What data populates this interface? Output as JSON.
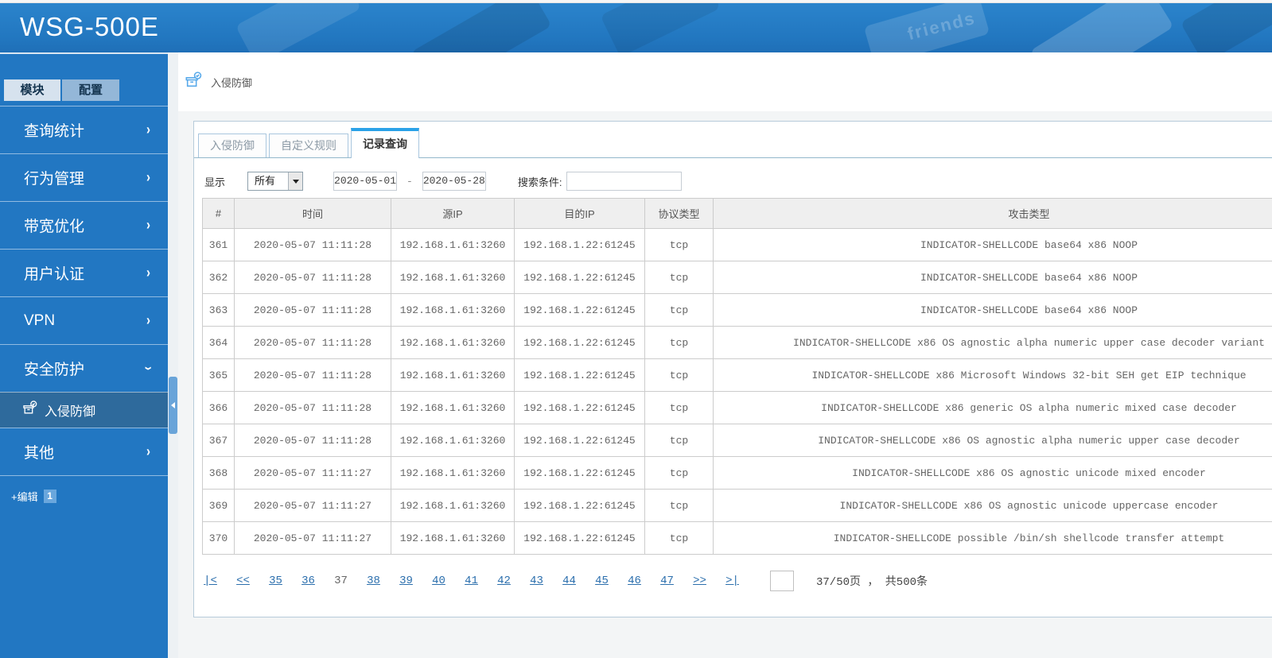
{
  "header": {
    "title": "WSG-500E",
    "keyboard_key_label": "friends"
  },
  "sidebar": {
    "tabs": [
      {
        "label": "模块",
        "active": true
      },
      {
        "label": "配置",
        "active": false
      }
    ],
    "menu": [
      {
        "name": "sidebar-item-query-stats",
        "label": "查询统计",
        "type": "group",
        "state": "collapsed"
      },
      {
        "name": "sidebar-item-behavior-mgmt",
        "label": "行为管理",
        "type": "group",
        "state": "collapsed"
      },
      {
        "name": "sidebar-item-bandwidth",
        "label": "带宽优化",
        "type": "group",
        "state": "collapsed"
      },
      {
        "name": "sidebar-item-user-auth",
        "label": "用户认证",
        "type": "group",
        "state": "collapsed"
      },
      {
        "name": "sidebar-item-vpn",
        "label": "VPN",
        "type": "group",
        "state": "collapsed"
      },
      {
        "name": "sidebar-item-security",
        "label": "安全防护",
        "type": "group",
        "state": "expanded"
      },
      {
        "name": "sidebar-item-ips",
        "label": "入侵防御",
        "type": "sub",
        "icon": "box-check-icon",
        "active": true
      },
      {
        "name": "sidebar-item-other",
        "label": "其他",
        "type": "group",
        "state": "collapsed"
      }
    ],
    "edit": {
      "label": "+编辑",
      "badge": "1"
    }
  },
  "breadcrumb": {
    "icon": "box-check-icon",
    "label": "入侵防御"
  },
  "tabs": [
    {
      "label": "入侵防御",
      "active": false
    },
    {
      "label": "自定义规则",
      "active": false
    },
    {
      "label": "记录查询",
      "active": true
    }
  ],
  "filters": {
    "display_label": "显示",
    "display_value": "所有",
    "date_from": "2020-05-01",
    "date_separator": "-",
    "date_to": "2020-05-28",
    "search_label": "搜索条件:",
    "search_value": ""
  },
  "table": {
    "columns": [
      "#",
      "时间",
      "源IP",
      "目的IP",
      "协议类型",
      "攻击类型"
    ],
    "rows": [
      [
        "361",
        "2020-05-07 11:11:28",
        "192.168.1.61:3260",
        "192.168.1.22:61245",
        "tcp",
        "INDICATOR-SHELLCODE base64 x86 NOOP"
      ],
      [
        "362",
        "2020-05-07 11:11:28",
        "192.168.1.61:3260",
        "192.168.1.22:61245",
        "tcp",
        "INDICATOR-SHELLCODE base64 x86 NOOP"
      ],
      [
        "363",
        "2020-05-07 11:11:28",
        "192.168.1.61:3260",
        "192.168.1.22:61245",
        "tcp",
        "INDICATOR-SHELLCODE base64 x86 NOOP"
      ],
      [
        "364",
        "2020-05-07 11:11:28",
        "192.168.1.61:3260",
        "192.168.1.22:61245",
        "tcp",
        "INDICATOR-SHELLCODE x86 OS agnostic alpha numeric upper case decoder variant"
      ],
      [
        "365",
        "2020-05-07 11:11:28",
        "192.168.1.61:3260",
        "192.168.1.22:61245",
        "tcp",
        "INDICATOR-SHELLCODE x86 Microsoft Windows 32-bit SEH get EIP technique"
      ],
      [
        "366",
        "2020-05-07 11:11:28",
        "192.168.1.61:3260",
        "192.168.1.22:61245",
        "tcp",
        "INDICATOR-SHELLCODE x86 generic OS alpha numeric mixed case decoder"
      ],
      [
        "367",
        "2020-05-07 11:11:28",
        "192.168.1.61:3260",
        "192.168.1.22:61245",
        "tcp",
        "INDICATOR-SHELLCODE x86 OS agnostic alpha numeric upper case decoder"
      ],
      [
        "368",
        "2020-05-07 11:11:27",
        "192.168.1.61:3260",
        "192.168.1.22:61245",
        "tcp",
        "INDICATOR-SHELLCODE x86 OS agnostic unicode mixed encoder"
      ],
      [
        "369",
        "2020-05-07 11:11:27",
        "192.168.1.61:3260",
        "192.168.1.22:61245",
        "tcp",
        "INDICATOR-SHELLCODE x86 OS agnostic unicode uppercase encoder"
      ],
      [
        "370",
        "2020-05-07 11:11:27",
        "192.168.1.61:3260",
        "192.168.1.22:61245",
        "tcp",
        "INDICATOR-SHELLCODE possible /bin/sh shellcode transfer attempt"
      ]
    ]
  },
  "pagination": {
    "items": [
      {
        "label": "|<",
        "name": "page-first"
      },
      {
        "label": "<<",
        "name": "page-prev-block"
      },
      {
        "label": "35",
        "name": "page-link"
      },
      {
        "label": "36",
        "name": "page-link"
      },
      {
        "label": "37",
        "name": "page-current",
        "current": true
      },
      {
        "label": "38",
        "name": "page-link"
      },
      {
        "label": "39",
        "name": "page-link"
      },
      {
        "label": "40",
        "name": "page-link"
      },
      {
        "label": "41",
        "name": "page-link"
      },
      {
        "label": "42",
        "name": "page-link"
      },
      {
        "label": "43",
        "name": "page-link"
      },
      {
        "label": "44",
        "name": "page-link"
      },
      {
        "label": "45",
        "name": "page-link"
      },
      {
        "label": "46",
        "name": "page-link"
      },
      {
        "label": "47",
        "name": "page-link"
      },
      {
        "label": ">>",
        "name": "page-next-block"
      },
      {
        "label": ">|",
        "name": "page-last"
      }
    ],
    "page_input_value": "",
    "summary": "37/50页 ， 共500条"
  }
}
